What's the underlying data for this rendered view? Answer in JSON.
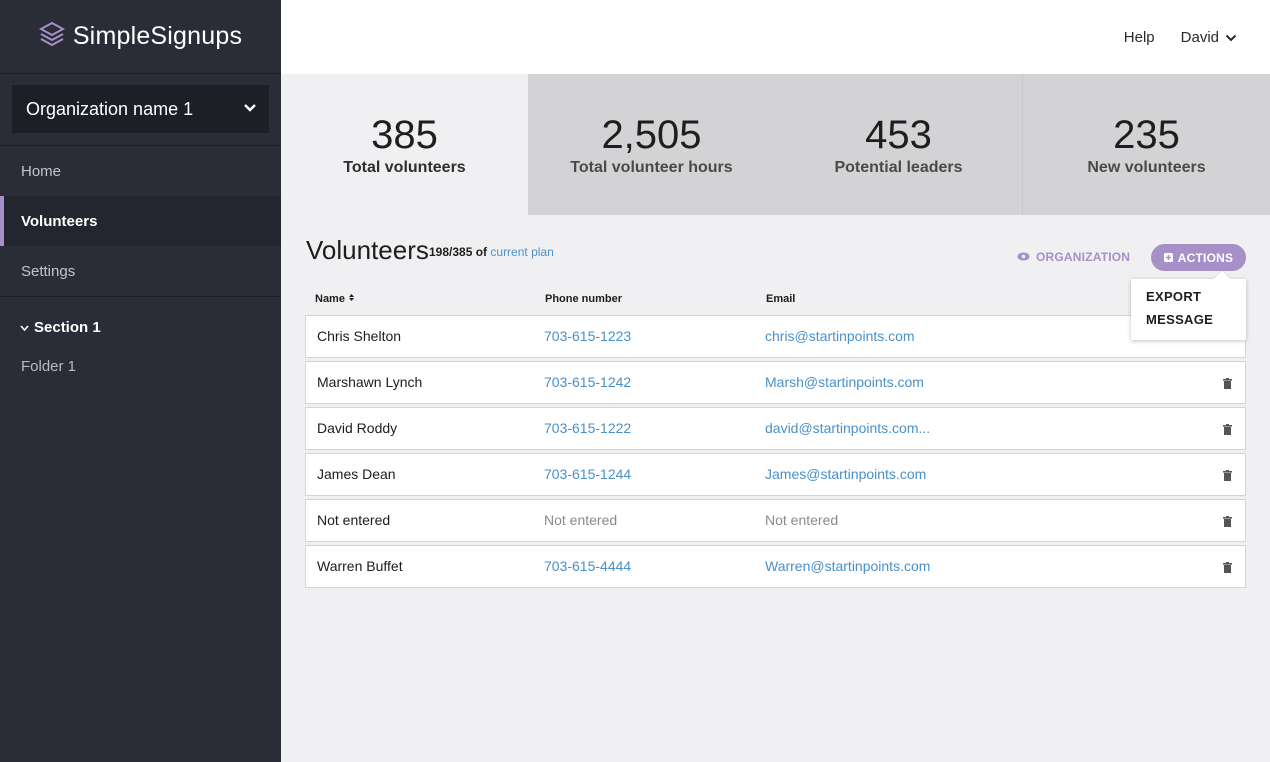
{
  "sidebar": {
    "logo": "SimpleSignups",
    "org_select": "Organization name 1",
    "nav": [
      "Home",
      "Volunteers",
      "Settings"
    ],
    "section": "Section 1",
    "folder": "Folder 1"
  },
  "topbar": {
    "help": "Help",
    "user": "David"
  },
  "stats": [
    {
      "value": "385",
      "label": "Total volunteers"
    },
    {
      "value": "2,505",
      "label": "Total volunteer hours"
    },
    {
      "value": "453",
      "label": "Potential leaders"
    },
    {
      "value": "235",
      "label": "New volunteers"
    }
  ],
  "main": {
    "title": "Volunteers",
    "quota_count": "198/385 of",
    "quota_link": "current plan",
    "org_toggle": "ORGANIZATION",
    "actions": "ACTIONS",
    "dropdown": [
      "EXPORT",
      "MESSAGE"
    ],
    "columns": [
      "Name",
      "Phone number",
      "Email"
    ],
    "rows": [
      {
        "name": "Chris Shelton",
        "phone": "703-615-1223",
        "email": "chris@startinpoints.com"
      },
      {
        "name": "Marshawn Lynch",
        "phone": "703-615-1242",
        "email": "Marsh@startinpoints.com"
      },
      {
        "name": "David Roddy",
        "phone": "703-615-1222",
        "email": "david@startinpoints.com..."
      },
      {
        "name": "James Dean",
        "phone": "703-615-1244",
        "email": "James@startinpoints.com"
      },
      {
        "name": "Not entered",
        "phone": "Not entered",
        "email": "Not entered"
      },
      {
        "name": "Warren Buffet",
        "phone": "703-615-4444",
        "email": "Warren@startinpoints.com"
      }
    ]
  },
  "colors": {
    "accent": "#a78fc7",
    "link": "#4a90c9",
    "sidebar": "#2a2d38"
  }
}
